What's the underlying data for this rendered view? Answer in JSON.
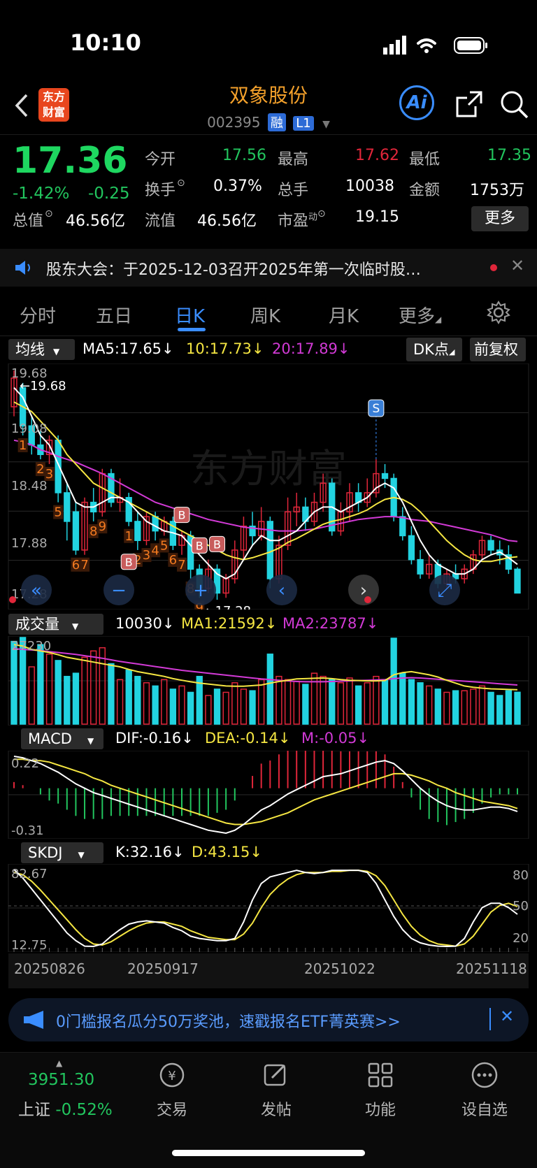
{
  "status_bar": {
    "time": "10:10"
  },
  "header": {
    "app_logo_line1": "东方",
    "app_logo_line2": "财富",
    "title": "双象股份",
    "code": "002395",
    "badge_rong": "融",
    "badge_level": "L1",
    "ai_label": "Ai"
  },
  "quote": {
    "price": "17.36",
    "change_pct": "-1.42%",
    "change": "-0.25",
    "stats_row1": [
      {
        "label": "今开",
        "value": "17.56"
      },
      {
        "label": "最高",
        "value": "17.62"
      },
      {
        "label": "最低",
        "value": "17.35"
      }
    ],
    "stats_row2": [
      {
        "label": "换手",
        "value": "0.37%"
      },
      {
        "label": "总手",
        "value": "10038"
      },
      {
        "label": "金额",
        "value": "1753万"
      }
    ],
    "stats_row3": [
      {
        "label": "总值",
        "value": "46.56亿"
      },
      {
        "label": "流值",
        "value": "46.56亿"
      },
      {
        "label": "市盈",
        "sup": "动",
        "value": "19.15"
      }
    ],
    "more_label": "更多"
  },
  "notice": {
    "text": "股东大会：于2025-12-03召开2025年第一次临时股…"
  },
  "tabs": [
    {
      "label": "分时"
    },
    {
      "label": "五日"
    },
    {
      "label": "日K"
    },
    {
      "label": "周K"
    },
    {
      "label": "月K"
    },
    {
      "label": "更多"
    }
  ],
  "main_chart": {
    "indicator": "均线",
    "ma5": "MA5:17.65",
    "ma10": "10:17.73",
    "ma20": "20:17.89",
    "dk_button": "DK点",
    "adjust_button": "前复权",
    "y_labels": [
      "19.68",
      "19.08",
      "18.48",
      "17.88",
      "17.28"
    ],
    "high_marker": "19.68",
    "low_marker": "17.28",
    "signal_s": "S",
    "signal_b": "B",
    "watermark": "东方财富",
    "seq_labels_orange": [
      "1",
      "2",
      "3",
      "5",
      "6",
      "7",
      "8",
      "9",
      "1",
      "2",
      "3",
      "4",
      "5",
      "6",
      "7",
      "8",
      "9"
    ]
  },
  "volume_panel": {
    "indicator": "成交量",
    "volume": "10030",
    "ma1": "MA1:21592",
    "ma2": "MA2:23787",
    "top_label": "27230"
  },
  "macd_panel": {
    "indicator": "MACD",
    "dif": "DIF:-0.16",
    "dea": "DEA:-0.14",
    "m": "M:-0.05",
    "top_label": "0.22",
    "bottom_label": "-0.31"
  },
  "skdj_panel": {
    "indicator": "SKDJ",
    "k": "K:32.16",
    "d": "D:43.15",
    "top_label": "82.67",
    "bottom_label": "12.75",
    "right_labels": [
      "80",
      "50",
      "20"
    ]
  },
  "x_axis_dates": [
    "20250826",
    "20250917",
    "20251022",
    "20251118"
  ],
  "chart_data": {
    "type": "candlestick",
    "title": "双象股份 002395 日K",
    "ylim": [
      17.28,
      19.68
    ],
    "candles": [
      {
        "o": 19.3,
        "c": 19.6,
        "h": 19.68,
        "l": 19.2
      },
      {
        "o": 19.5,
        "c": 19.1,
        "h": 19.55,
        "l": 19.0
      },
      {
        "o": 19.1,
        "c": 18.9,
        "h": 19.2,
        "l": 18.8
      },
      {
        "o": 18.9,
        "c": 18.8,
        "h": 19.05,
        "l": 18.75
      },
      {
        "o": 18.8,
        "c": 18.95,
        "h": 19.0,
        "l": 18.7
      },
      {
        "o": 18.95,
        "c": 18.4,
        "h": 19.0,
        "l": 18.3
      },
      {
        "o": 18.4,
        "c": 18.1,
        "h": 18.5,
        "l": 17.9
      },
      {
        "o": 18.2,
        "c": 17.8,
        "h": 18.3,
        "l": 17.75
      },
      {
        "o": 17.8,
        "c": 18.3,
        "h": 18.35,
        "l": 17.75
      },
      {
        "o": 18.3,
        "c": 18.2,
        "h": 18.45,
        "l": 18.1
      },
      {
        "o": 18.2,
        "c": 18.6,
        "h": 18.65,
        "l": 18.15
      },
      {
        "o": 18.6,
        "c": 18.3,
        "h": 18.65,
        "l": 18.25
      },
      {
        "o": 18.3,
        "c": 18.35,
        "h": 18.55,
        "l": 18.2
      },
      {
        "o": 18.35,
        "c": 18.1,
        "h": 18.4,
        "l": 18.05
      },
      {
        "o": 18.1,
        "c": 17.9,
        "h": 18.2,
        "l": 17.8
      },
      {
        "o": 17.9,
        "c": 18.15,
        "h": 18.2,
        "l": 17.85
      },
      {
        "o": 18.15,
        "c": 18.0,
        "h": 18.2,
        "l": 17.9
      },
      {
        "o": 18.0,
        "c": 18.1,
        "h": 18.15,
        "l": 17.95
      },
      {
        "o": 18.1,
        "c": 17.85,
        "h": 18.15,
        "l": 17.8
      },
      {
        "o": 17.85,
        "c": 17.95,
        "h": 18.0,
        "l": 17.75
      },
      {
        "o": 17.95,
        "c": 17.6,
        "h": 18.0,
        "l": 17.5
      },
      {
        "o": 17.6,
        "c": 17.4,
        "h": 17.65,
        "l": 17.3
      },
      {
        "o": 17.4,
        "c": 17.6,
        "h": 17.7,
        "l": 17.35
      },
      {
        "o": 17.6,
        "c": 17.35,
        "h": 17.65,
        "l": 17.28
      },
      {
        "o": 17.35,
        "c": 17.5,
        "h": 17.55,
        "l": 17.3
      },
      {
        "o": 17.5,
        "c": 17.8,
        "h": 17.9,
        "l": 17.45
      },
      {
        "o": 17.8,
        "c": 18.05,
        "h": 18.15,
        "l": 17.7
      },
      {
        "o": 18.05,
        "c": 17.95,
        "h": 18.2,
        "l": 17.85
      },
      {
        "o": 17.95,
        "c": 18.1,
        "h": 18.25,
        "l": 17.9
      },
      {
        "o": 18.1,
        "c": 17.5,
        "h": 18.15,
        "l": 17.4
      },
      {
        "o": 17.5,
        "c": 17.85,
        "h": 17.95,
        "l": 17.45
      },
      {
        "o": 17.85,
        "c": 18.2,
        "h": 18.35,
        "l": 17.8
      },
      {
        "o": 18.2,
        "c": 18.25,
        "h": 18.4,
        "l": 18.05
      },
      {
        "o": 18.25,
        "c": 18.1,
        "h": 18.35,
        "l": 18.0
      },
      {
        "o": 18.1,
        "c": 18.3,
        "h": 18.4,
        "l": 18.05
      },
      {
        "o": 18.3,
        "c": 18.5,
        "h": 18.6,
        "l": 18.2
      },
      {
        "o": 18.5,
        "c": 18.0,
        "h": 18.55,
        "l": 17.95
      },
      {
        "o": 18.0,
        "c": 18.2,
        "h": 18.3,
        "l": 17.95
      },
      {
        "o": 18.2,
        "c": 18.4,
        "h": 18.5,
        "l": 18.1
      },
      {
        "o": 18.4,
        "c": 18.3,
        "h": 18.5,
        "l": 18.2
      },
      {
        "o": 18.3,
        "c": 18.4,
        "h": 18.55,
        "l": 18.25
      },
      {
        "o": 18.4,
        "c": 18.6,
        "h": 18.75,
        "l": 18.35
      },
      {
        "o": 18.6,
        "c": 18.55,
        "h": 18.7,
        "l": 18.45
      },
      {
        "o": 18.55,
        "c": 18.15,
        "h": 18.6,
        "l": 18.1
      },
      {
        "o": 18.15,
        "c": 17.95,
        "h": 18.25,
        "l": 17.9
      },
      {
        "o": 17.95,
        "c": 17.7,
        "h": 18.05,
        "l": 17.65
      },
      {
        "o": 17.7,
        "c": 17.55,
        "h": 17.8,
        "l": 17.5
      },
      {
        "o": 17.55,
        "c": 17.65,
        "h": 17.75,
        "l": 17.5
      },
      {
        "o": 17.65,
        "c": 17.45,
        "h": 17.7,
        "l": 17.4
      },
      {
        "o": 17.45,
        "c": 17.55,
        "h": 17.6,
        "l": 17.4
      },
      {
        "o": 17.55,
        "c": 17.5,
        "h": 17.65,
        "l": 17.45
      },
      {
        "o": 17.5,
        "c": 17.6,
        "h": 17.65,
        "l": 17.45
      },
      {
        "o": 17.6,
        "c": 17.75,
        "h": 17.8,
        "l": 17.55
      },
      {
        "o": 17.75,
        "c": 17.9,
        "h": 17.95,
        "l": 17.7
      },
      {
        "o": 17.9,
        "c": 17.8,
        "h": 17.95,
        "l": 17.75
      },
      {
        "o": 17.8,
        "c": 17.75,
        "h": 17.9,
        "l": 17.65
      },
      {
        "o": 17.75,
        "c": 17.6,
        "h": 17.85,
        "l": 17.55
      },
      {
        "o": 17.6,
        "c": 17.35,
        "h": 17.62,
        "l": 17.35
      }
    ],
    "ma5": [
      19.5,
      19.4,
      19.2,
      19.0,
      18.9,
      18.7,
      18.5,
      18.3,
      18.25,
      18.25,
      18.3,
      18.35,
      18.35,
      18.3,
      18.2,
      18.1,
      18.05,
      18.0,
      17.98,
      17.95,
      17.85,
      17.75,
      17.65,
      17.55,
      17.5,
      17.55,
      17.7,
      17.85,
      17.95,
      17.9,
      17.9,
      17.95,
      18.0,
      18.1,
      18.2,
      18.25,
      18.25,
      18.2,
      18.25,
      18.3,
      18.35,
      18.45,
      18.5,
      18.45,
      18.3,
      18.1,
      17.9,
      17.75,
      17.65,
      17.6,
      17.55,
      17.55,
      17.6,
      17.7,
      17.75,
      17.78,
      17.72,
      17.65
    ],
    "ma10": [
      19.35,
      19.3,
      19.25,
      19.15,
      19.05,
      18.95,
      18.8,
      18.7,
      18.6,
      18.5,
      18.45,
      18.4,
      18.35,
      18.3,
      18.25,
      18.2,
      18.15,
      18.1,
      18.05,
      18.0,
      17.95,
      17.9,
      17.85,
      17.8,
      17.75,
      17.72,
      17.7,
      17.72,
      17.75,
      17.78,
      17.82,
      17.88,
      17.92,
      17.97,
      18.02,
      18.07,
      18.1,
      18.12,
      18.15,
      18.18,
      18.22,
      18.28,
      18.33,
      18.35,
      18.33,
      18.28,
      18.2,
      18.1,
      18.0,
      17.9,
      17.82,
      17.75,
      17.7,
      17.68,
      17.68,
      17.7,
      17.72,
      17.73
    ],
    "ma20": [
      18.95,
      18.93,
      18.9,
      18.85,
      18.82,
      18.78,
      18.75,
      18.72,
      18.68,
      18.64,
      18.6,
      18.55,
      18.5,
      18.45,
      18.4,
      18.35,
      18.3,
      18.27,
      18.24,
      18.21,
      18.18,
      18.15,
      18.12,
      18.1,
      18.08,
      18.06,
      18.04,
      18.03,
      18.02,
      18.01,
      18.0,
      18.0,
      18.0,
      18.01,
      18.02,
      18.04,
      18.06,
      18.08,
      18.1,
      18.12,
      18.13,
      18.14,
      18.15,
      18.15,
      18.14,
      18.12,
      18.11,
      18.1,
      18.08,
      18.06,
      18.04,
      18.02,
      18.0,
      17.98,
      17.96,
      17.93,
      17.9,
      17.89
    ],
    "volumes": [
      26000,
      27230,
      18000,
      25000,
      22000,
      20000,
      15000,
      16000,
      21000,
      23000,
      24000,
      19000,
      14000,
      17000,
      15000,
      13000,
      12000,
      14000,
      11000,
      12000,
      10000,
      15000,
      9000,
      11000,
      10000,
      13000,
      11000,
      10500,
      14000,
      22000,
      15000,
      14000,
      13500,
      12500,
      16000,
      15000,
      14000,
      13000,
      14500,
      12000,
      13000,
      15000,
      14000,
      27000,
      16000,
      14000,
      13000,
      12000,
      11000,
      10000,
      10500,
      10500,
      11000,
      12000,
      10000,
      9000,
      10500,
      10030
    ],
    "volume_up": [
      false,
      false,
      true,
      false,
      true,
      false,
      false,
      false,
      true,
      true,
      true,
      false,
      true,
      false,
      false,
      true,
      false,
      true,
      false,
      true,
      false,
      false,
      true,
      false,
      true,
      true,
      true,
      false,
      true,
      false,
      true,
      true,
      true,
      false,
      true,
      true,
      false,
      true,
      true,
      false,
      true,
      true,
      false,
      false,
      false,
      false,
      false,
      true,
      false,
      true,
      false,
      true,
      true,
      true,
      false,
      false,
      false,
      false
    ],
    "vol_ma1": [
      25000,
      24500,
      23500,
      23000,
      22500,
      21800,
      21000,
      20500,
      20000,
      19500,
      19000,
      18500,
      18000,
      17200,
      16500,
      16000,
      15500,
      15000,
      14300,
      13800,
      13300,
      12900,
      12600,
      12300,
      12000,
      11900,
      11900,
      12100,
      12300,
      12900,
      13400,
      13800,
      14200,
      14300,
      14400,
      14500,
      14300,
      14000,
      13800,
      13700,
      13600,
      13600,
      13700,
      15500,
      16200,
      16500,
      16000,
      15500,
      14800,
      13800,
      12900,
      12000,
      11600,
      11300,
      11100,
      11000,
      10900,
      10800
    ],
    "vol_ma2": [
      23700,
      23500,
      23300,
      23100,
      22800,
      22500,
      22200,
      21900,
      21500,
      21100,
      20700,
      20200,
      19700,
      19300,
      18900,
      18500,
      18100,
      17700,
      17300,
      16900,
      16600,
      16300,
      16000,
      15700,
      15400,
      15100,
      14800,
      14500,
      14200,
      14000,
      13800,
      13600,
      13400,
      13300,
      13300,
      13300,
      13400,
      13500,
      13600,
      13700,
      13800,
      13900,
      14000,
      14300,
      14500,
      14600,
      14500,
      14300,
      14100,
      13900,
      13700,
      13500,
      13300,
      13100,
      12900,
      12700,
      12500,
      12300
    ],
    "macd_dif": [
      0.22,
      0.21,
      0.19,
      0.17,
      0.14,
      0.11,
      0.07,
      0.03,
      0.0,
      -0.03,
      -0.05,
      -0.07,
      -0.09,
      -0.11,
      -0.13,
      -0.15,
      -0.17,
      -0.19,
      -0.21,
      -0.23,
      -0.25,
      -0.27,
      -0.29,
      -0.3,
      -0.31,
      -0.29,
      -0.25,
      -0.2,
      -0.15,
      -0.12,
      -0.08,
      -0.04,
      -0.01,
      0.02,
      0.05,
      0.08,
      0.09,
      0.1,
      0.12,
      0.14,
      0.16,
      0.18,
      0.19,
      0.17,
      0.12,
      0.06,
      0.0,
      -0.05,
      -0.09,
      -0.12,
      -0.14,
      -0.15,
      -0.15,
      -0.14,
      -0.13,
      -0.13,
      -0.14,
      -0.16
    ],
    "macd_dea": [
      0.2,
      0.2,
      0.19,
      0.19,
      0.18,
      0.16,
      0.14,
      0.12,
      0.1,
      0.07,
      0.05,
      0.02,
      0.0,
      -0.02,
      -0.04,
      -0.06,
      -0.08,
      -0.1,
      -0.12,
      -0.14,
      -0.16,
      -0.18,
      -0.2,
      -0.22,
      -0.24,
      -0.25,
      -0.25,
      -0.24,
      -0.23,
      -0.21,
      -0.19,
      -0.17,
      -0.14,
      -0.11,
      -0.08,
      -0.06,
      -0.04,
      -0.02,
      0.0,
      0.02,
      0.04,
      0.06,
      0.08,
      0.1,
      0.1,
      0.09,
      0.07,
      0.05,
      0.02,
      0.0,
      -0.03,
      -0.05,
      -0.07,
      -0.09,
      -0.1,
      -0.11,
      -0.12,
      -0.14
    ],
    "skdj_k": [
      82.67,
      75,
      65,
      55,
      45,
      35,
      25,
      18,
      13,
      12.75,
      15,
      22,
      28,
      33,
      35,
      36,
      35,
      34,
      30,
      27,
      22,
      20,
      19,
      18,
      18,
      20,
      35,
      55,
      70,
      76,
      78,
      80,
      82,
      80,
      79,
      80,
      82,
      82,
      82,
      82,
      80,
      70,
      55,
      40,
      28,
      20,
      16,
      14,
      13,
      12.75,
      13,
      20,
      35,
      48,
      52,
      52,
      48,
      42,
      32.16
    ],
    "skdj_d": [
      80,
      78,
      72,
      64,
      55,
      46,
      37,
      28,
      20,
      15,
      14,
      17,
      22,
      27,
      31,
      34,
      35,
      35,
      33,
      31,
      27,
      24,
      21,
      20,
      19,
      19,
      24,
      34,
      48,
      60,
      68,
      74,
      78,
      80,
      80,
      80,
      81,
      81,
      82,
      82,
      81,
      77,
      68,
      55,
      42,
      31,
      23,
      18,
      15,
      14,
      13,
      15,
      22,
      33,
      44,
      50,
      52,
      49,
      43.15
    ]
  },
  "banner": {
    "text": "0门槛报名瓜分50万奖池，速戳报名ETF菁英赛>>"
  },
  "bottom_nav": {
    "index_value": "3951.30",
    "index_name": "上证",
    "index_change": "-0.52%",
    "items": [
      {
        "label": "交易"
      },
      {
        "label": "发帖"
      },
      {
        "label": "功能"
      },
      {
        "label": "设自选"
      }
    ]
  },
  "colors": {
    "up_red": "#e0263a",
    "down_cyan": "#22d3e0",
    "ma5_white": "#ffffff",
    "ma10_yellow": "#f5e642",
    "ma20_magenta": "#d23ad6",
    "accent_blue": "#3a8dff",
    "brand_orange": "#f4a12b"
  }
}
